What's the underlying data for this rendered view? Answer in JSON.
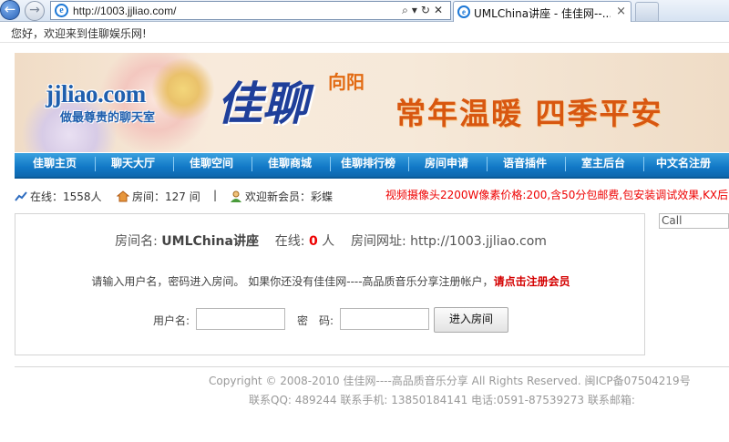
{
  "browser": {
    "address_url": "http://1003.jjliao.com/",
    "tab_title": "UMLChina讲座 - 佳佳网--...",
    "back_glyph": "←",
    "forward_glyph": "→",
    "address_tools": "⌕▾↻✕",
    "tab_close": "×",
    "ie_glyph": "e"
  },
  "welcome_text": "您好，欢迎来到佳聊娱乐网!",
  "banner": {
    "logo_text": "jjliao.com",
    "logo_subtitle": "做最尊贵的聊天室",
    "brand": "佳聊",
    "brand_small": "向阳",
    "slogan": "常年温暖 四季平安"
  },
  "nav": {
    "items": [
      "佳聊主页",
      "聊天大厅",
      "佳聊空间",
      "佳聊商城",
      "佳聊排行榜",
      "房间申请",
      "语音插件",
      "室主后台",
      "中文名注册"
    ]
  },
  "stats": {
    "online": "在线：1558人",
    "rooms": "房间：127 间",
    "divider": "|",
    "new_member": "欢迎新会员：彩蝶",
    "marquee": "视频摄像头2200W像素价格:200,含50分包邮费,包安装调试效果,KX后台"
  },
  "room": {
    "name_label": "房间名:",
    "name_value": "UMLChina讲座",
    "online_label": "在线:",
    "online_count": "0",
    "online_unit": "人",
    "url_label": "房间网址:",
    "url_value": "http://1003.jjliao.com",
    "prompt": "请输入用户名，密码进入房间。   如果你还没有佳佳网----高品质音乐分享注册帐户，",
    "register_link": "请点击注册会员",
    "username_label": "用户名:",
    "password_label": "密　码:",
    "enter_button": "进入房间"
  },
  "side": {
    "call_placeholder": "Call"
  },
  "footer": {
    "copyright": "Copyright © 2008-2010 佳佳网----高品质音乐分享 All Rights Reserved.   闽ICP备07504219号",
    "contact": "联系QQ: 489244   联系手机: 13850184141 电话:0591-87539273   联系邮箱:"
  }
}
